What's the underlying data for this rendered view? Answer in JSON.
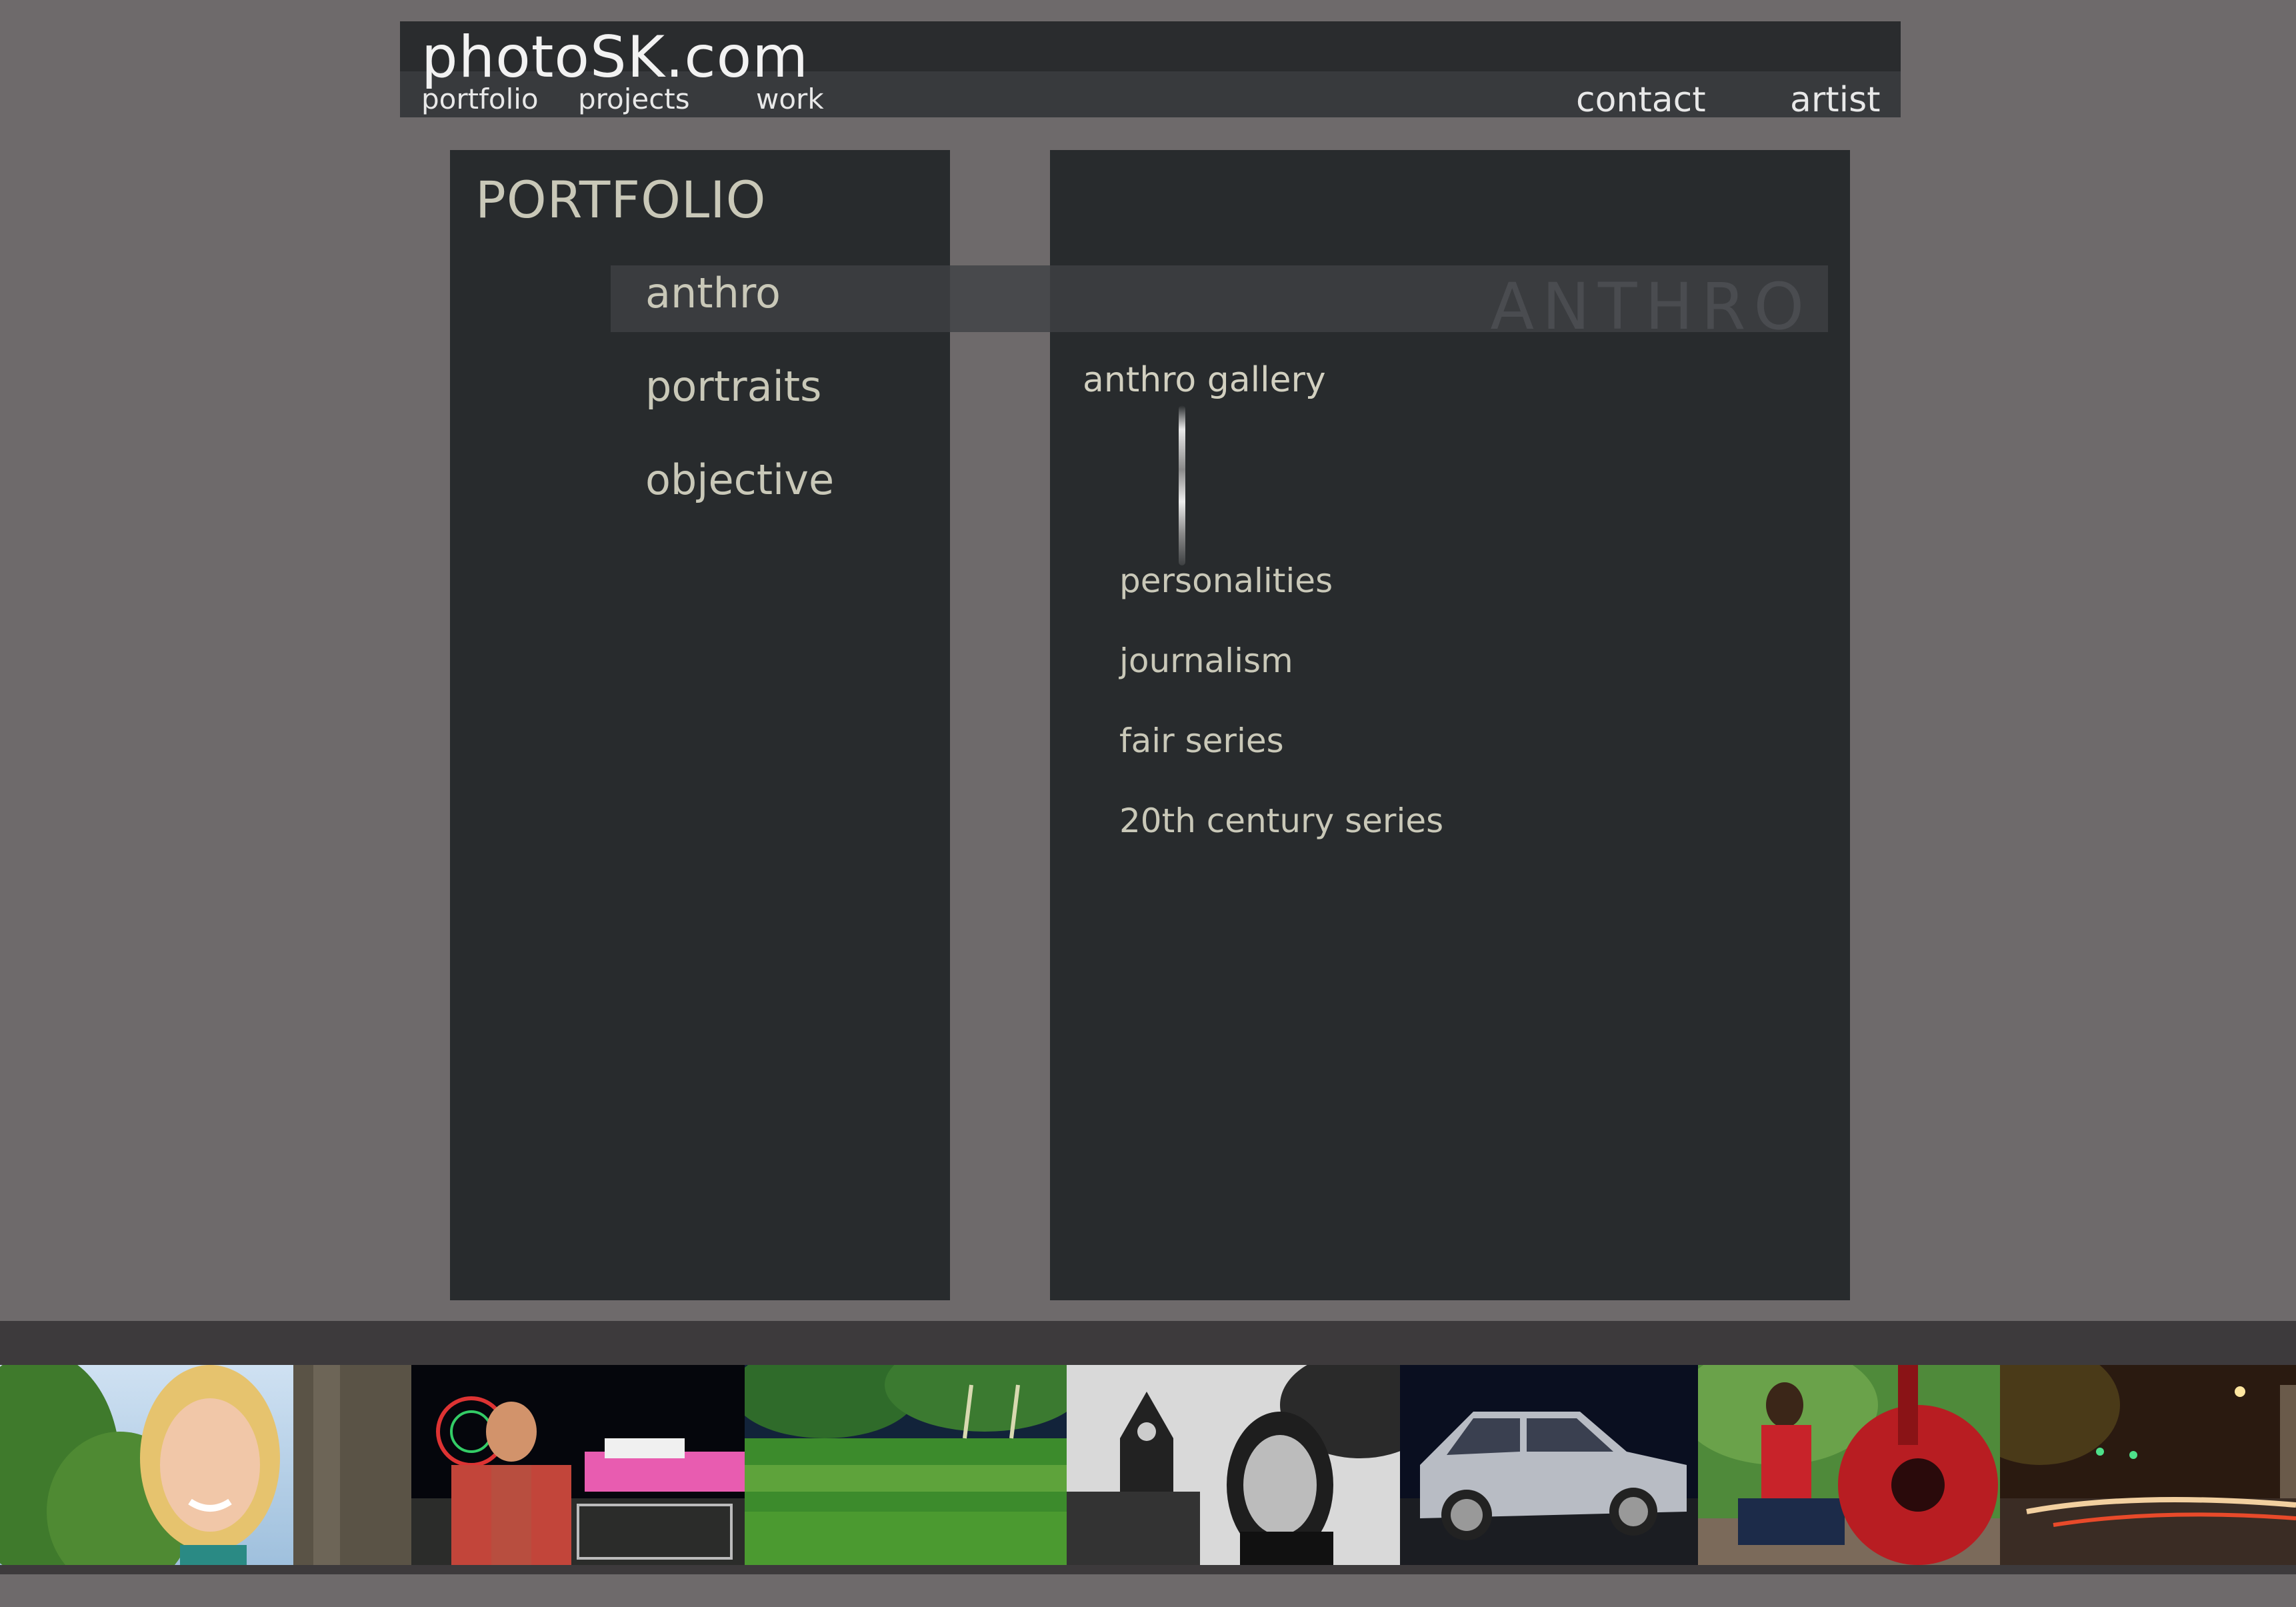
{
  "header": {
    "logo": "photoSK.com",
    "nav_left": [
      "portfolio",
      "projects",
      "work"
    ],
    "nav_right": [
      "contact",
      "artist"
    ]
  },
  "portfolio": {
    "title": "PORTFOLIO",
    "categories": [
      "anthro",
      "portraits",
      "objective"
    ],
    "selected": "anthro",
    "watermark": "ANTHRO"
  },
  "gallery": {
    "title": "anthro gallery",
    "items": [
      "personalities",
      "journalism",
      "fair series",
      "20th century series"
    ]
  },
  "colors": {
    "page_bg": "#6e6a6b",
    "panel_bg": "#282b2d",
    "accent_text": "#c9c8b8"
  }
}
